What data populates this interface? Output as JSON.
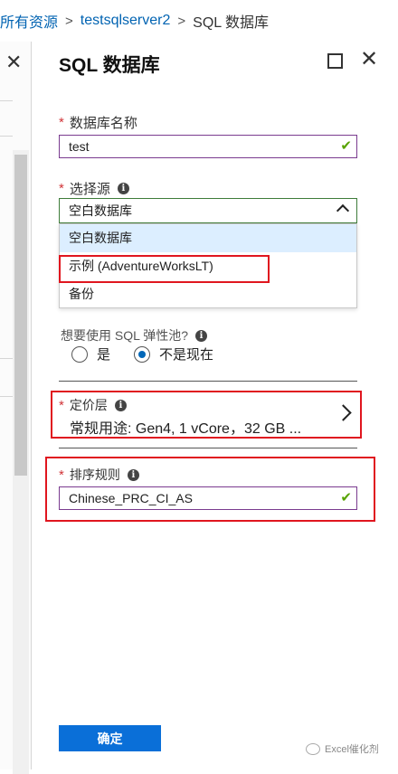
{
  "breadcrumb": {
    "items": [
      "所有资源",
      "testsqlserver2",
      "SQL 数据库"
    ],
    "separator": ">"
  },
  "left_blade": {
    "close_glyph": "✕"
  },
  "blade": {
    "title": "SQL 数据库",
    "close_glyph": "✕"
  },
  "form": {
    "required_mark": "*",
    "db_name": {
      "label": "数据库名称",
      "value": "test",
      "valid_glyph": "✔"
    },
    "source": {
      "label": "选择源",
      "selected": "空白数据库",
      "options": [
        "空白数据库",
        "示例 (AdventureWorksLT)",
        "备份"
      ]
    },
    "elastic_pool": {
      "question": "想要使用 SQL 弹性池?",
      "options": [
        "是",
        "不是现在"
      ],
      "selected": "不是现在"
    },
    "pricing_tier": {
      "label": "定价层",
      "value": "常规用途: Gen4, 1 vCore，32 GB ..."
    },
    "collation": {
      "label": "排序规则",
      "value": "Chinese_PRC_CI_AS",
      "valid_glyph": "✔"
    },
    "info_glyph": "i"
  },
  "footer": {
    "confirm_label": "确定"
  },
  "watermark": {
    "text": "Excel催化剂"
  },
  "colors": {
    "accent": "#0a6fd8",
    "highlight_box": "#e0161f",
    "valid": "#57a300"
  }
}
